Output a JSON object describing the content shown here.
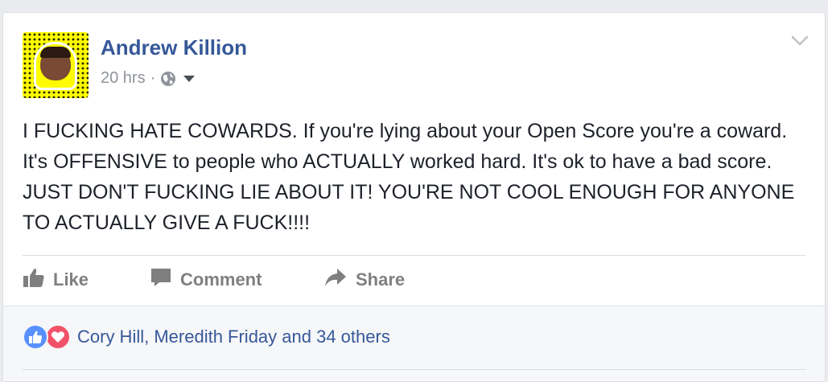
{
  "post": {
    "author": "Andrew Killion",
    "time": "20 hrs",
    "separator": "·",
    "privacy_icon": "globe-icon",
    "text": "I FUCKING HATE COWARDS. If you're lying about your Open Score you're a coward. It's OFFENSIVE to people who ACTUALLY worked hard. It's ok to have a bad score. JUST DON'T FUCKING LIE ABOUT IT! YOU'RE NOT COOL ENOUGH FOR ANYONE TO ACTUALLY GIVE A FUCK!!!!"
  },
  "actions": {
    "like": "Like",
    "comment": "Comment",
    "share": "Share"
  },
  "reactions": {
    "summary": "Cory Hill, Meredith Friday and 34 others",
    "icons": [
      "like-reaction-icon",
      "love-reaction-icon"
    ]
  },
  "colors": {
    "link": "#365899",
    "muted": "#90949c",
    "action_text": "#7f7f7f",
    "like_reaction": "#5890ff",
    "love_reaction": "#f25268",
    "avatar_bg": "#fffc00"
  }
}
